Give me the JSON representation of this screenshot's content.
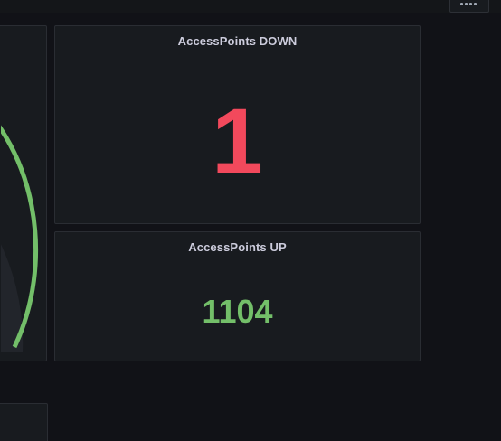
{
  "panels": {
    "down": {
      "title": "AccessPoints DOWN",
      "value": "1",
      "color": "#f2495c"
    },
    "up": {
      "title": "AccessPoints UP",
      "value": "1104",
      "color": "#73bf69"
    }
  },
  "gauge": {
    "arc_color": "#73bf69",
    "fill_color": "#22252b"
  },
  "theme": {
    "background": "#111217",
    "panel_background": "#181b1f",
    "panel_border": "#2a2d33",
    "title_color": "#ccccdc"
  },
  "top_control": {
    "icon": "view-menu-icon"
  }
}
